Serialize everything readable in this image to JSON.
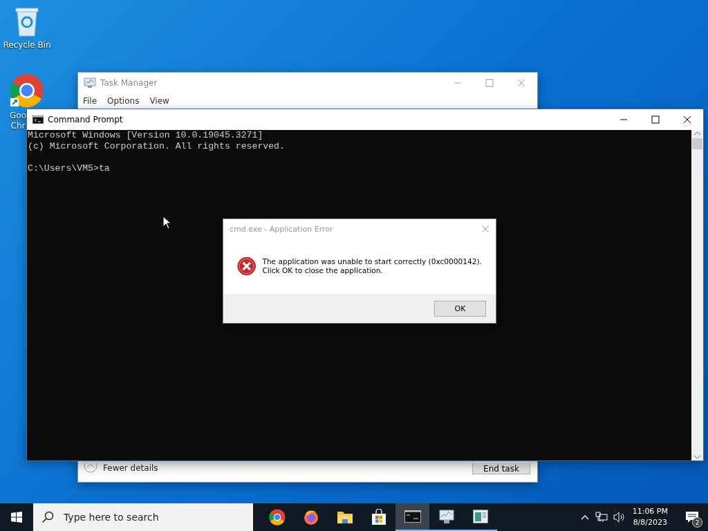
{
  "desktop_icons": [
    {
      "kind": "recycle",
      "label_lines": [
        "Recycle Bin"
      ]
    },
    {
      "kind": "chrome",
      "label_lines": [
        "Goo",
        "Chr"
      ]
    }
  ],
  "task_manager": {
    "title": "Task Manager",
    "menu": [
      "File",
      "Options",
      "View"
    ],
    "fewer_details": "Fewer details",
    "end_task": "End task"
  },
  "command_prompt": {
    "title": "Command Prompt",
    "blocks": [
      [
        "Microsoft Windows [Version 10.0.19045.3271]",
        "(c) Microsoft Corporation. All rights reserved."
      ],
      [
        "C:\\Users\\VM5>ta"
      ]
    ]
  },
  "dialog": {
    "title": "cmd.exe - Application Error",
    "message_lines": [
      "The application was unable to start correctly (0xc0000142).",
      "Click OK to close the application."
    ],
    "button": "OK"
  },
  "taskbar": {
    "search_placeholder": "Type here to search",
    "apps": [
      {
        "kind": "chrome",
        "running": false,
        "selected": false
      },
      {
        "kind": "firefox",
        "running": false,
        "selected": false
      },
      {
        "kind": "folder",
        "running": false,
        "selected": false
      },
      {
        "kind": "store",
        "running": false,
        "selected": false
      },
      {
        "kind": "cmd",
        "running": true,
        "selected": true
      },
      {
        "kind": "taskmgr",
        "running": true,
        "selected": false
      },
      {
        "kind": "window",
        "running": true,
        "selected": false
      }
    ],
    "time": "11:06 PM",
    "date": "8/8/2023",
    "notifications": "2"
  }
}
